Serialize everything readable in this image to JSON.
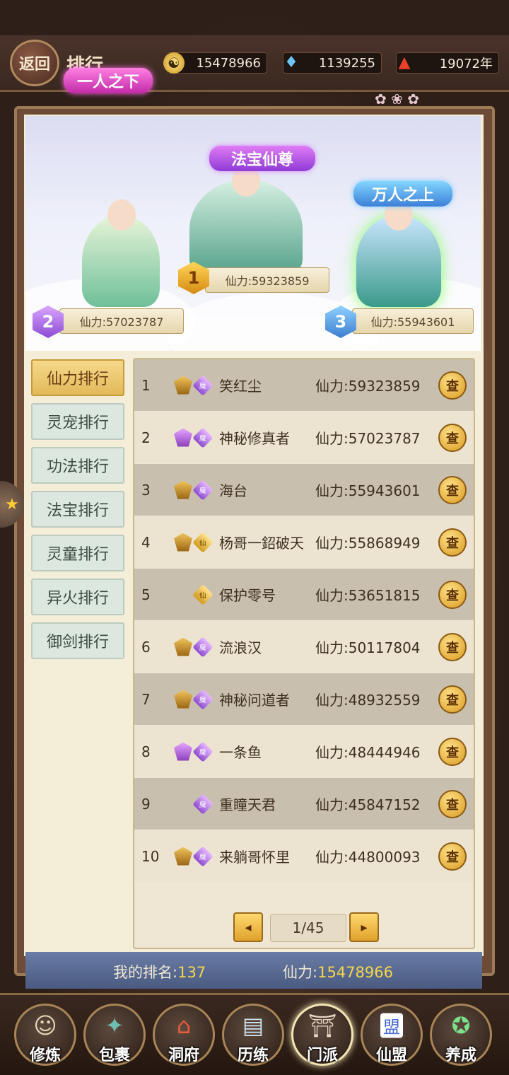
{
  "header": {
    "back_label": "返回",
    "title": "排行",
    "resources": [
      {
        "icon": "taiji-coin-icon",
        "value": "15478966"
      },
      {
        "icon": "crystal-icon",
        "value": "1139255"
      },
      {
        "icon": "mountain-icon",
        "value": "19072年"
      }
    ]
  },
  "podium": {
    "first": {
      "title": "法宝仙尊",
      "rank": "1",
      "power": "仙力:59323859"
    },
    "second": {
      "title": "一人之下",
      "rank": "2",
      "power": "仙力:57023787"
    },
    "third": {
      "title": "万人之上",
      "rank": "3",
      "power": "仙力:55943601"
    }
  },
  "tabs": [
    {
      "label": "仙力排行",
      "active": true
    },
    {
      "label": "灵宠排行",
      "active": false
    },
    {
      "label": "功法排行",
      "active": false
    },
    {
      "label": "法宝排行",
      "active": false
    },
    {
      "label": "灵童排行",
      "active": false
    },
    {
      "label": "异火排行",
      "active": false
    },
    {
      "label": "御剑排行",
      "active": false
    }
  ],
  "rows": [
    {
      "rank": "1",
      "badge_a": "gold",
      "badge_b": "魔",
      "badge_b_color": "purple",
      "name": "笑红尘",
      "power": "仙力:59323859",
      "view": "查"
    },
    {
      "rank": "2",
      "badge_a": "purple",
      "badge_b": "魔",
      "badge_b_color": "purple",
      "name": "神秘修真者",
      "power": "仙力:57023787",
      "view": "查"
    },
    {
      "rank": "3",
      "badge_a": "gold",
      "badge_b": "魔",
      "badge_b_color": "purple",
      "name": "海台",
      "power": "仙力:55943601",
      "view": "查"
    },
    {
      "rank": "4",
      "badge_a": "gold",
      "badge_b": "仙",
      "badge_b_color": "gold",
      "name": "杨哥一鉊破天",
      "power": "仙力:55868949",
      "view": "查"
    },
    {
      "rank": "5",
      "badge_a": "",
      "badge_b": "仙",
      "badge_b_color": "gold",
      "name": "保护零号",
      "power": "仙力:53651815",
      "view": "查"
    },
    {
      "rank": "6",
      "badge_a": "gold",
      "badge_b": "魔",
      "badge_b_color": "purple",
      "name": "流浪汉",
      "power": "仙力:50117804",
      "view": "查"
    },
    {
      "rank": "7",
      "badge_a": "gold",
      "badge_b": "魔",
      "badge_b_color": "purple",
      "name": "神秘问道者",
      "power": "仙力:48932559",
      "view": "查"
    },
    {
      "rank": "8",
      "badge_a": "purple",
      "badge_b": "魔",
      "badge_b_color": "purple",
      "name": "一条鱼",
      "power": "仙力:48444946",
      "view": "查"
    },
    {
      "rank": "9",
      "badge_a": "",
      "badge_b": "魔",
      "badge_b_color": "purple",
      "name": "重瞳天君",
      "power": "仙力:45847152",
      "view": "查"
    },
    {
      "rank": "10",
      "badge_a": "gold",
      "badge_b": "魔",
      "badge_b_color": "purple",
      "name": "来躺哥怀里",
      "power": "仙力:44800093",
      "view": "查"
    }
  ],
  "pagination": {
    "prev": "◂",
    "next": "▸",
    "label": "1/45"
  },
  "my_rank": {
    "rank_label": "我的排名:",
    "rank_value": "137",
    "power_label": "仙力:",
    "power_value": "15478966"
  },
  "bottom_nav": [
    {
      "label": "修炼",
      "icon": "cultivator-icon",
      "selected": false
    },
    {
      "label": "包裹",
      "icon": "bag-icon",
      "selected": false
    },
    {
      "label": "洞府",
      "icon": "palace-icon",
      "selected": false
    },
    {
      "label": "历练",
      "icon": "scroll-icon",
      "selected": false
    },
    {
      "label": "门派",
      "icon": "sect-gate-icon",
      "selected": true
    },
    {
      "label": "仙盟",
      "icon": "alliance-icon",
      "selected": false
    },
    {
      "label": "养成",
      "icon": "pentagram-icon",
      "selected": false
    }
  ]
}
